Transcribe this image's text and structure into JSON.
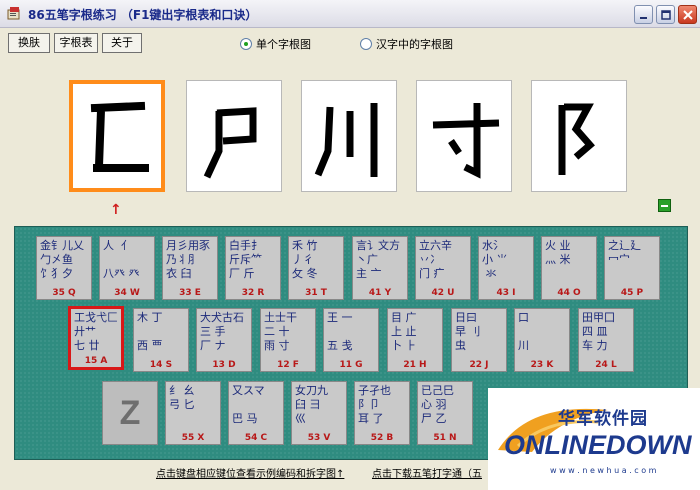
{
  "window": {
    "title": "86五笔字根练习  （F1键出字根表和口诀）"
  },
  "toolbar": {
    "skin": "换肤",
    "table": "字根表",
    "about": "关于"
  },
  "radios": [
    {
      "label": "单个字根图",
      "selected": true
    },
    {
      "label": "汉字中的字根图",
      "selected": false
    }
  ],
  "arrow": "↑",
  "keys_row1": [
    {
      "glyphs": "金钅儿乂\n勹㐅鱼\n饣犭夕",
      "label": "35 Q"
    },
    {
      "glyphs": "人  亻\n\n八癶 癶",
      "label": "34 W"
    },
    {
      "glyphs": "月彡用豕\n乃丬⺼\n衣 臼",
      "label": "33 E"
    },
    {
      "glyphs": "白手扌\n斤斥⺮\n厂 斤",
      "label": "32 R"
    },
    {
      "glyphs": "禾 竹\n丿彳\n攵 冬",
      "label": "31 T"
    },
    {
      "glyphs": "言讠文方\n丶广\n主 亠",
      "label": "41 Y"
    },
    {
      "glyphs": "立六辛\n丷冫\n门 疒",
      "label": "42 U"
    },
    {
      "glyphs": "水氵 \n小 ⺌\n 氺",
      "label": "43 I"
    },
    {
      "glyphs": "火 业\n灬 米\n  ",
      "label": "44 O"
    },
    {
      "glyphs": "之辶廴\n冖宀\n ",
      "label": "45 P"
    }
  ],
  "keys_row2": [
    {
      "glyphs": "工戈弋匚\n廾艹\n七 廿",
      "label": "15 A"
    },
    {
      "glyphs": "木 丁\n\n西 覀",
      "label": "14 S"
    },
    {
      "glyphs": "大犬古石\n三 手\n厂 ナ",
      "label": "13 D"
    },
    {
      "glyphs": "土士干\n二 十\n雨 寸",
      "label": "12 F"
    },
    {
      "glyphs": "王 一\n\n五 戋",
      "label": "11 G"
    },
    {
      "glyphs": "目 广\n上 止\n卜 ⺊",
      "label": "21 H"
    },
    {
      "glyphs": "日曰\n早 刂\n虫",
      "label": "22 J"
    },
    {
      "glyphs": "口\n\n川",
      "label": "23 K"
    },
    {
      "glyphs": "田甲囗\n四 皿\n车 力",
      "label": "24 L"
    }
  ],
  "keys_row3": [
    {
      "glyphs": "纟 幺\n弓 匕\n  ",
      "label": "55 X"
    },
    {
      "glyphs": "又スマ\n\n巴 马",
      "label": "54 C"
    },
    {
      "glyphs": "女刀九\n臼 彐\n巛 ",
      "label": "53 V"
    },
    {
      "glyphs": "子孑也\n阝卩\n耳 了",
      "label": "52 B"
    },
    {
      "glyphs": "已己巳\n心 羽\n尸 乙",
      "label": "51 N"
    }
  ],
  "zkey": "Z",
  "bottom": {
    "left": "点击键盘相应键位查看示例编码和拆字图↑",
    "right": "点击下载五笔打字通（五"
  },
  "watermark": {
    "cn": "华军软件园",
    "brand": "ONLINEDOWN",
    "url": "w w w . n e w h u a . c o m"
  }
}
